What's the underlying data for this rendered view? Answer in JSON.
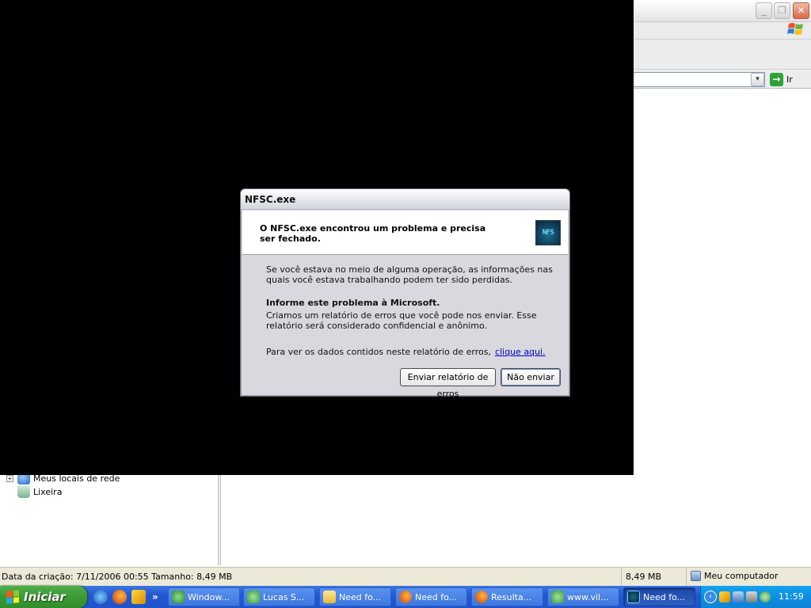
{
  "explorer": {
    "address_dropdown_glyph": "▾",
    "go_label": "Ir",
    "tree_items": [
      {
        "label": "Meus locais de rede",
        "icon": "network-places-icon",
        "expander": "+"
      },
      {
        "label": "Lixeira",
        "icon": "recycle-bin-icon"
      }
    ],
    "status": {
      "details": "Data da criação: 7/11/2006 00:55 Tamanho: 8,49 MB",
      "size": "8,49 MB",
      "zone": "Meu computador"
    }
  },
  "dialog": {
    "title": "NFSC.exe",
    "header": "O NFSC.exe encontrou um problema e precisa ser fechado.",
    "logo_text": "NFS",
    "info": "Se você estava no meio de alguma operação, as informações nas quais você estava trabalhando podem ter sido perdidas.",
    "report_heading": "Informe este problema à Microsoft.",
    "report_body": "Criamos um relatório de erros que você pode nos enviar. Esse relatório será considerado confidencial e anônimo.",
    "view_text": "Para ver os dados contidos neste relatório de erros,",
    "view_link": "clique aqui.",
    "send_button": "Enviar relatório de erros",
    "dont_send_button": "Não enviar"
  },
  "taskbar": {
    "start_label": "Iniciar",
    "quicklaunch_chevron": "»",
    "tasks": [
      {
        "label": "Window...",
        "icon": "msn-messenger-icon",
        "active": false
      },
      {
        "label": "Lucas S...",
        "icon": "msn-contact-icon",
        "active": false
      },
      {
        "label": "Need fo...",
        "icon": "folder-icon",
        "active": false
      },
      {
        "label": "Need fo...",
        "icon": "firefox-icon",
        "active": false
      },
      {
        "label": "Resulta...",
        "icon": "firefox-icon",
        "active": false
      },
      {
        "label": "www.vil...",
        "icon": "msn-contact-icon",
        "active": false
      },
      {
        "label": "Need fo...",
        "icon": "nfs-game-icon",
        "active": true
      }
    ],
    "tray_expand_glyph": "‹",
    "clock": "11:59"
  },
  "colors": {
    "taskbar_blue": "#2458d2",
    "start_green": "#3b9a35",
    "tray_blue": "#0f8ee0",
    "link_blue": "#0000cc"
  }
}
